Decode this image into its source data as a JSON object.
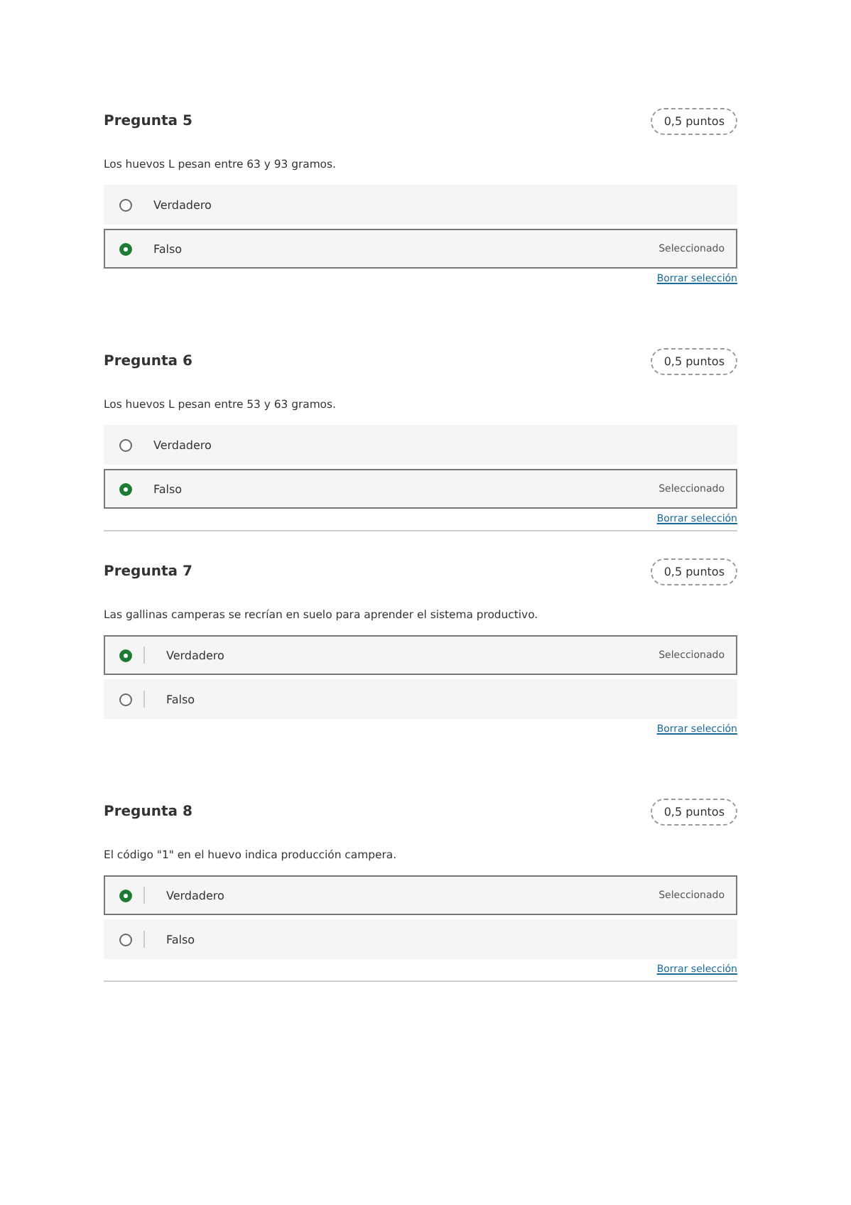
{
  "questions": [
    {
      "title": "Pregunta 5",
      "points": "0,5 puntos",
      "prompt": "Los huevos L pesan entre 63 y 93 gramos.",
      "divided": false,
      "rule": false,
      "clear": "Borrar selección",
      "options": [
        {
          "label": "Verdadero",
          "selected": false
        },
        {
          "label": "Falso",
          "selected": true,
          "status": "Seleccionado"
        }
      ]
    },
    {
      "title": "Pregunta 6",
      "points": "0,5 puntos",
      "prompt": "Los huevos L pesan entre 53 y 63 gramos.",
      "divided": false,
      "rule": true,
      "clear": "Borrar selección",
      "options": [
        {
          "label": "Verdadero",
          "selected": false
        },
        {
          "label": "Falso",
          "selected": true,
          "status": "Seleccionado"
        }
      ]
    },
    {
      "title": "Pregunta 7",
      "points": "0,5 puntos",
      "prompt": "Las gallinas camperas se recrían en suelo para aprender el sistema productivo.",
      "divided": true,
      "rule": false,
      "clear": "Borrar selección",
      "options": [
        {
          "label": "Verdadero",
          "selected": true,
          "status": "Seleccionado"
        },
        {
          "label": "Falso",
          "selected": false
        }
      ]
    },
    {
      "title": "Pregunta 8",
      "points": "0,5 puntos",
      "prompt": "El código \"1\" en el huevo indica producción campera.",
      "divided": true,
      "rule": true,
      "clear": "Borrar selección",
      "options": [
        {
          "label": "Verdadero",
          "selected": true,
          "status": "Seleccionado"
        },
        {
          "label": "Falso",
          "selected": false
        }
      ]
    }
  ]
}
